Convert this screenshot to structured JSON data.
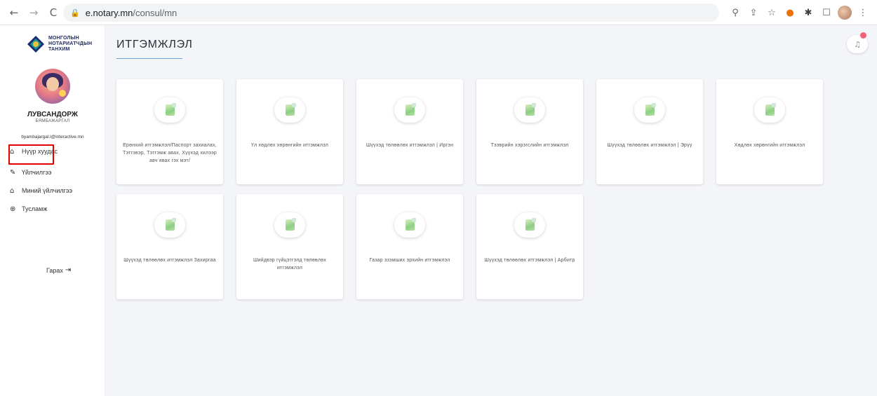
{
  "browser": {
    "url_host": "e.notary.mn",
    "url_path": "/consul/mn",
    "back_glyph": "←",
    "forward_glyph": "→",
    "reload_glyph": "C",
    "lock_glyph": "🔒",
    "zoom_glyph": "⚲",
    "share_glyph": "⇪",
    "star_glyph": "☆",
    "ext1_glyph": "●",
    "ext2_glyph": "✱",
    "window_glyph": "☐",
    "menu_glyph": "⋮"
  },
  "sidebar": {
    "logo_line1": "МОНГОЛЫН",
    "logo_line2": "НОТАРИАТЧДЫН",
    "logo_line3": "ТАНХИМ",
    "user_name": "ЛУВСАНДОРЖ",
    "user_sub": "БЯМБАЖАРГАЛ",
    "user_email": "byambajargal.l@interactive.mn",
    "menu": {
      "home": {
        "label": "Нүүр хуудас",
        "icon": "⌂"
      },
      "services": {
        "label": "Үйлчилгээ",
        "icon": "✎"
      },
      "my_services": {
        "label": "Миний үйлчилгээ",
        "icon": "⌂"
      },
      "help": {
        "label": "Тусламж",
        "icon": "⊕"
      }
    },
    "logout": {
      "label": "Гарах",
      "icon": "⇥"
    }
  },
  "main": {
    "title": "ИТГЭМЖЛЭЛ",
    "bell_glyph": "♫",
    "cards": [
      "Ерөнхий итгэмжлэл/Паспорт захиалах, Тэтгэвэр, Тэтгэмж авах, Хүүхэд хилээр авч явах гэх мэт/",
      "Үл хөдлөх хөрөнгийн итгэмжлэл",
      "Шүүхэд төлөөлөх итгэмжлэл | Иргэн",
      "Тээврийн хэрэгслийн итгэмжлэл",
      "Шүүхэд төлөөлөх итгэмжлэл | Эрүү",
      "Хөдлөх хөрөнгийн итгэмжлэл",
      "Шүүхэд төлөөлөх итгэмжлэл Захиргаа",
      "Шийдвэр гүйцэтгэлд төлөөлөх итгэмжлэл",
      "Газар эзэмших эрхийн итгэмжлэл",
      "Шүүхэд төлөөлөх итгэмжлэл | Арбитр"
    ]
  },
  "colors": {
    "highlight": "#e10000",
    "bell_dot": "#f06277",
    "accent_line": "#6da2d6"
  }
}
